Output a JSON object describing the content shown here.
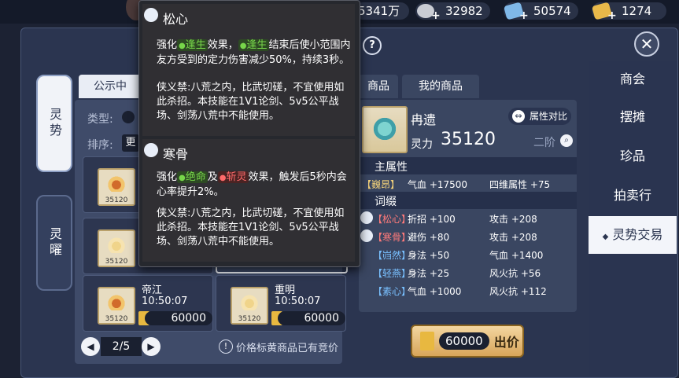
{
  "currencies": [
    {
      "value": "5341万",
      "icon": "silver-ingot-icon"
    },
    {
      "value": "32982",
      "icon": "silver-pile-icon"
    },
    {
      "value": "50574",
      "icon": "blue-ticket-icon"
    },
    {
      "value": "1274",
      "icon": "gold-ticket-icon"
    }
  ],
  "left_tabs": [
    "灵势",
    "灵曜"
  ],
  "top_tabs": [
    "公示中",
    "商品",
    "我的商品"
  ],
  "filters": {
    "type_label": "类型:",
    "sort_label": "排序:"
  },
  "cards": [
    {
      "name": "",
      "time": "",
      "price": "",
      "icon_price": "35120"
    },
    {
      "name": "",
      "time": "",
      "price": "",
      "icon_price": "35120"
    },
    {
      "name": "帝江",
      "time": "10:50:07",
      "price": "60000",
      "icon_price": "35120"
    },
    {
      "name": "重明",
      "time": "10:50:07",
      "price": "60000",
      "icon_price": "35120"
    }
  ],
  "pagination": {
    "page": "2/5",
    "note": "价格标黄商品已有竞价"
  },
  "detail": {
    "name": "冉遗",
    "power_label": "灵力",
    "power_value": "35120",
    "compare_label": "属性对比",
    "grade": "二阶",
    "main_attr_header": "主属性",
    "main_attr": {
      "tag": "【巍昂】",
      "stat1": "气血 +17500",
      "stat2": "四维属性 +75"
    },
    "affix_header": "词缀",
    "affixes": [
      {
        "tag": "【松心】",
        "stat1": "折招 +100",
        "stat2": "攻击 +208",
        "has_icon": true
      },
      {
        "tag": "【寒骨】",
        "stat1": "避伤 +80",
        "stat2": "攻击 +208",
        "has_icon": true
      },
      {
        "tag": "【岿然】",
        "stat1": "身法 +50",
        "stat2": "气血 +1400",
        "has_icon": false
      },
      {
        "tag": "【轻燕】",
        "stat1": "身法 +25",
        "stat2": "风火抗 +56",
        "has_icon": false
      },
      {
        "tag": "【素心】",
        "stat1": "气血 +1000",
        "stat2": "风火抗 +112",
        "has_icon": false
      }
    ],
    "price": "60000",
    "bid_label": "出价"
  },
  "right_nav": [
    "商会",
    "摆摊",
    "珍品",
    "拍卖行",
    "灵势交易"
  ],
  "tooltip": {
    "s1": {
      "title": "松心",
      "p1": [
        "强化",
        "逢生",
        "效果，",
        "逢生",
        "结束后使小范围内友方受到的定力伤害减少50%，持续3秒。"
      ],
      "p2": "侠义禁:八荒之内，比武切磋，不宜使用如此杀招。本技能在1V1论剑、5v5公平战场、剑荡八荒中不能使用。"
    },
    "s2": {
      "title": "寒骨",
      "p1": [
        "强化",
        "绝命",
        "及",
        "斩灵",
        "效果，触发后5秒内会心率提升2%。"
      ],
      "p2": "侠义禁:八荒之内，比武切磋，不宜使用如此杀招。本技能在1V1论剑、5v5公平战场、剑荡八荒中不能使用。"
    }
  },
  "colors": {
    "gold": "#f4d27a",
    "blue_tag": "#79c0ff",
    "red_tag": "#ff7a7a",
    "active_nav": "#f3f5fa"
  }
}
